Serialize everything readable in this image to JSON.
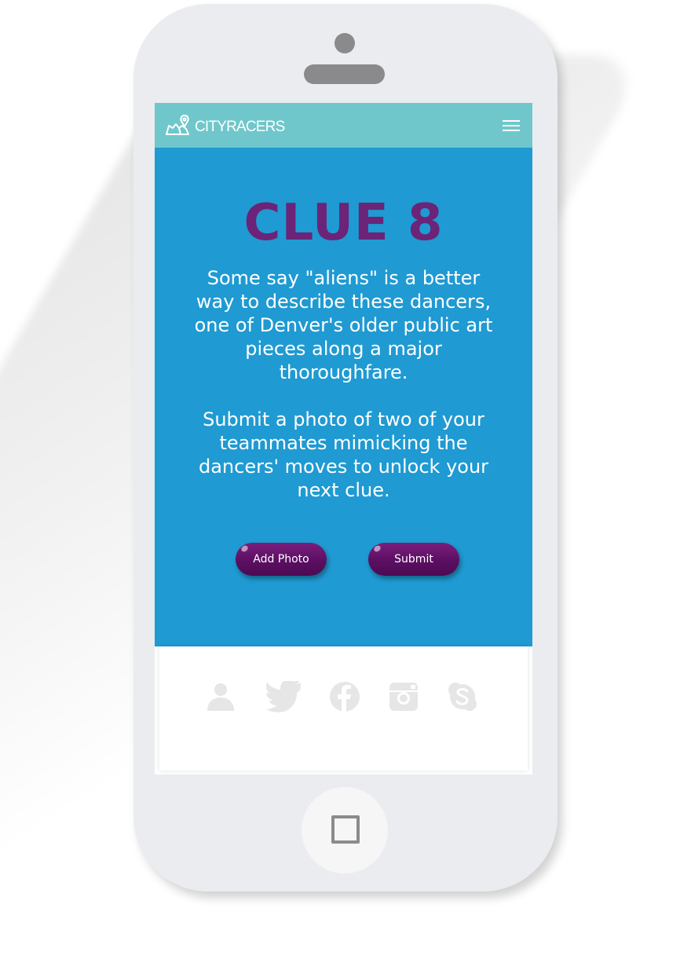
{
  "header": {
    "logo_text": "CITYRACERS",
    "menu_icon": "hamburger-menu-icon",
    "background_color": "#6fc7cb"
  },
  "clue": {
    "title": "CLUE 8",
    "description": "Some say \"aliens\" is a better way to describe these dancers, one of Denver's older public art pieces along a major thoroughfare.",
    "instructions": "Submit a photo of two of your teammates mimicking the dancers' moves to unlock your next clue.",
    "title_color": "#6b2477",
    "background_color": "#1f9ad2"
  },
  "buttons": {
    "add_photo": "Add Photo",
    "submit": "Submit",
    "button_color": "#5b0f62"
  },
  "social": {
    "icons": [
      "profile-icon",
      "twitter-icon",
      "facebook-icon",
      "instagram-icon",
      "skype-icon"
    ],
    "icon_color": "#e6e6e6"
  },
  "device": {
    "body_color": "#ebecef",
    "home_button_icon": "home-square-icon"
  }
}
